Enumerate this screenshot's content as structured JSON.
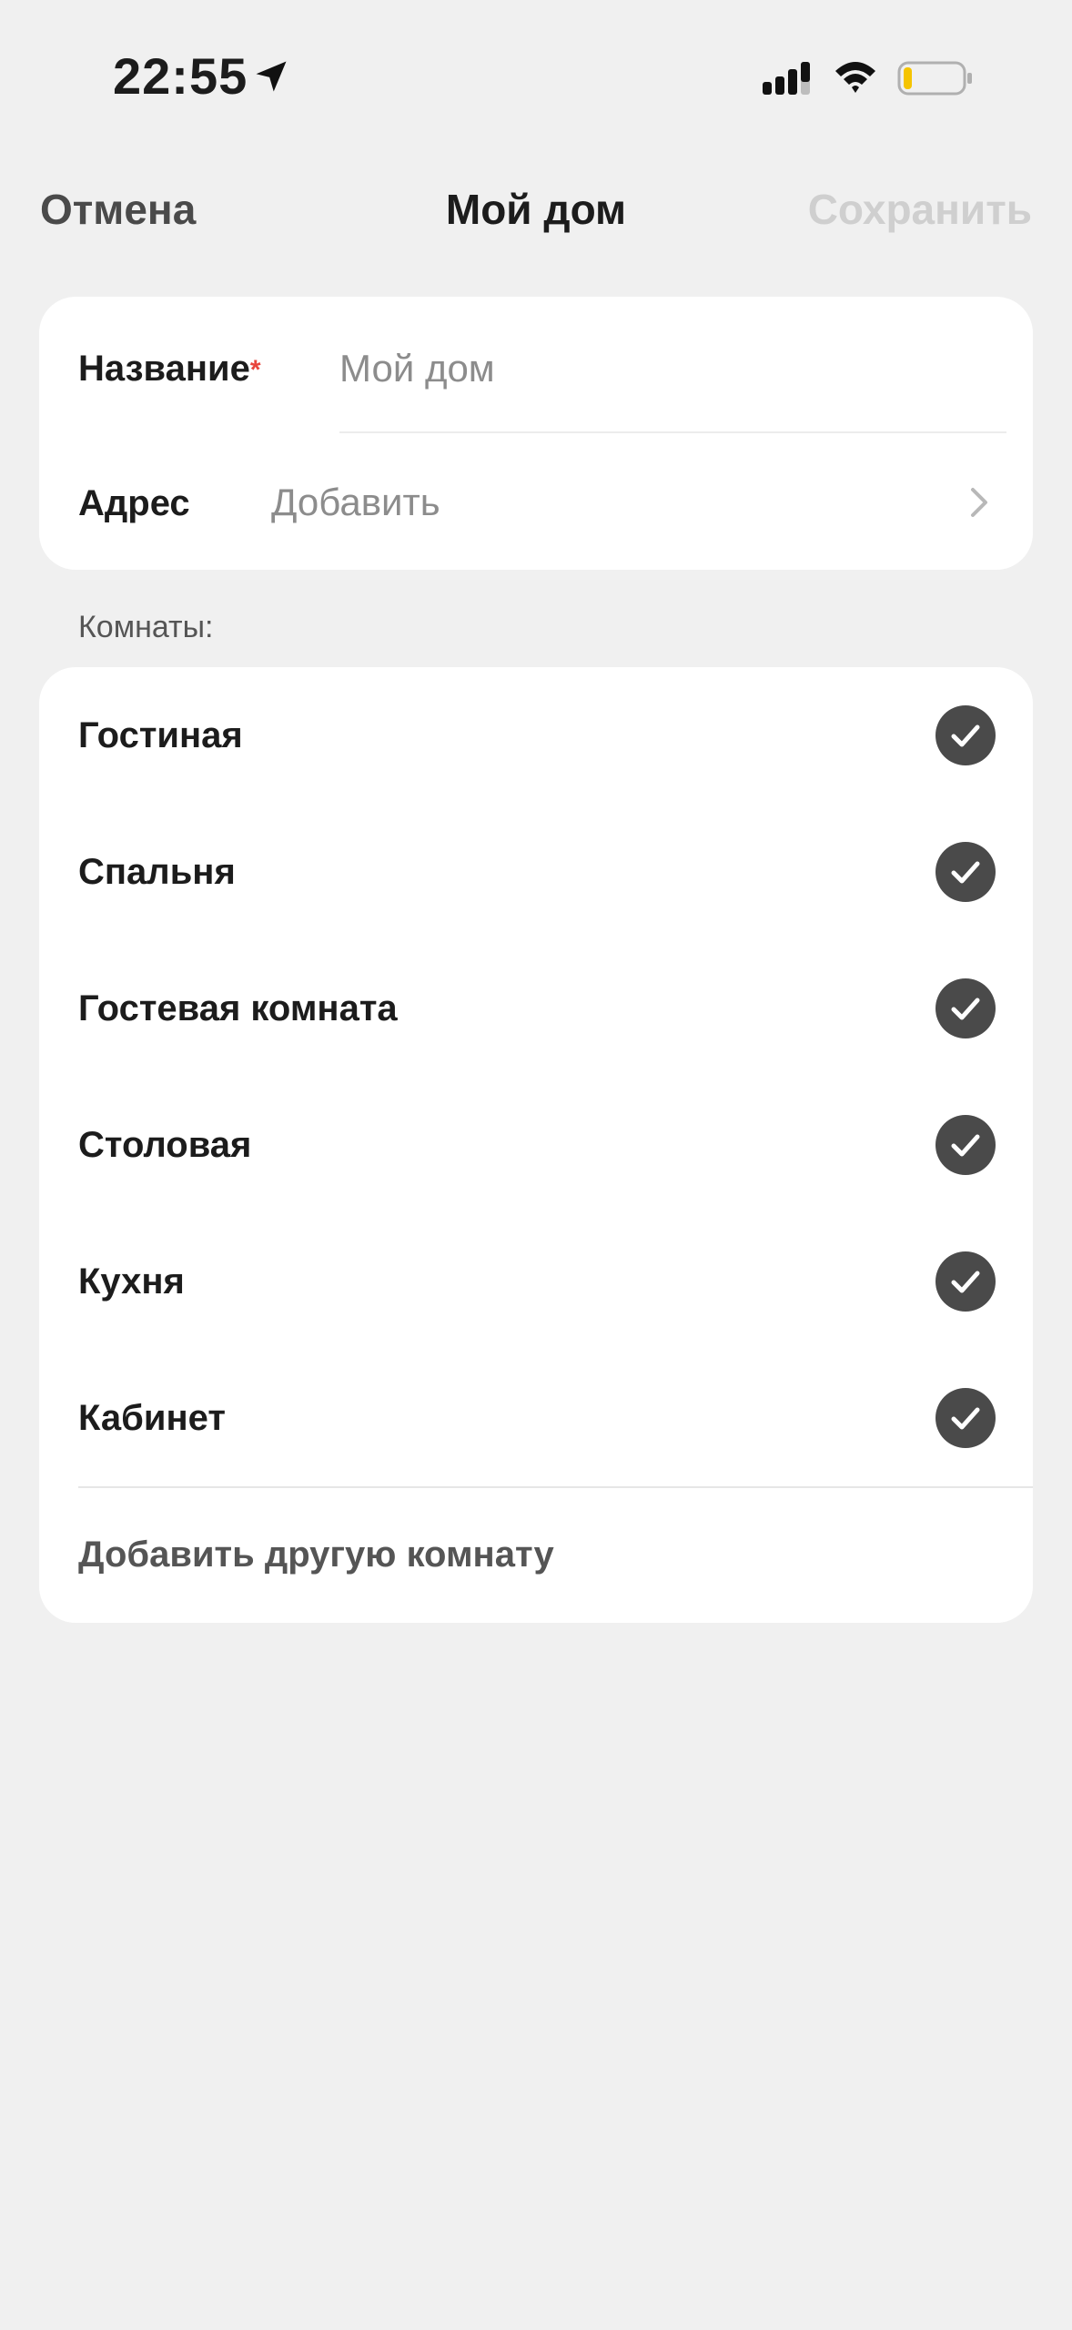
{
  "status_bar": {
    "time": "22:55",
    "icons": [
      "location-arrow-icon",
      "cellular-signal-icon",
      "wifi-icon",
      "battery-icon"
    ],
    "battery_level": 0.15,
    "battery_color": "#f5c400"
  },
  "nav": {
    "cancel_label": "Отмена",
    "title": "Мой дом",
    "save_label": "Сохранить"
  },
  "details": {
    "name_label": "Название",
    "required_mark": "*",
    "name_placeholder": "Мой дом",
    "name_value": "",
    "address_label": "Адрес",
    "address_value": "Добавить"
  },
  "rooms": {
    "section_label": "Комнаты:",
    "items": [
      {
        "label": "Гостиная",
        "checked": true
      },
      {
        "label": "Спальня",
        "checked": true
      },
      {
        "label": "Гостевая комната",
        "checked": true
      },
      {
        "label": "Столовая",
        "checked": true
      },
      {
        "label": "Кухня",
        "checked": true
      },
      {
        "label": "Кабинет",
        "checked": true
      }
    ],
    "add_label": "Добавить другую комнату"
  },
  "colors": {
    "background": "#f0f0f0",
    "card": "#ffffff",
    "check_fill": "#4a4a4a",
    "required": "#e8453c",
    "disabled": "#cfcfcf"
  }
}
